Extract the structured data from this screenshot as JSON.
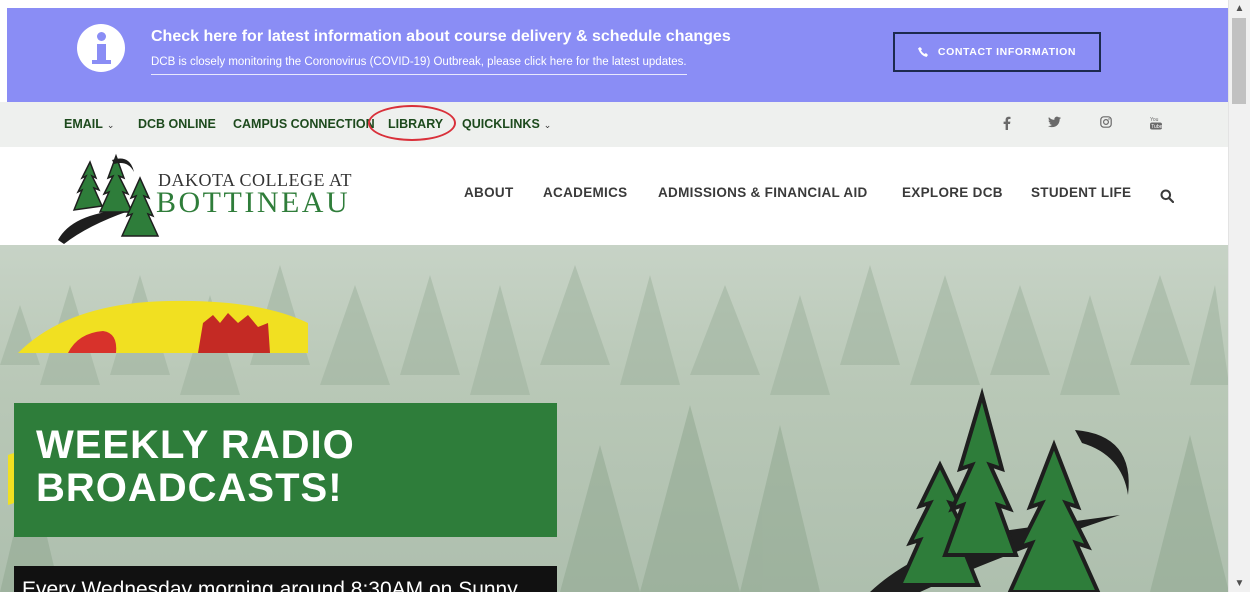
{
  "banner": {
    "title": "Check here for latest information about course delivery & schedule changes",
    "subtitle": "DCB is closely monitoring the Coronovirus (COVID-19) Outbreak, please click here for the latest updates.",
    "contact_button": "CONTACT INFORMATION",
    "color": "#8a8df5"
  },
  "utility_nav": {
    "items": [
      {
        "label": "EMAIL",
        "dropdown": true
      },
      {
        "label": "DCB ONLINE",
        "dropdown": false
      },
      {
        "label": "CAMPUS CONNECTION",
        "dropdown": false
      },
      {
        "label": "LIBRARY",
        "dropdown": false
      },
      {
        "label": "QUICKLINKS",
        "dropdown": true
      }
    ],
    "social": [
      "facebook-icon",
      "twitter-icon",
      "instagram-icon",
      "youtube-icon"
    ]
  },
  "logo": {
    "line1": "DAKOTA COLLEGE AT",
    "line2": "BOTTINEAU"
  },
  "main_nav": {
    "items": [
      "ABOUT",
      "ACADEMICS",
      "ADMISSIONS & FINANCIAL AID",
      "EXPLORE DCB",
      "STUDENT LIFE"
    ]
  },
  "hero": {
    "title_line1": "WEEKLY RADIO",
    "title_line2": "BROADCASTS!",
    "caption": "Every Wednesday morning around 8:30AM on Sunny"
  },
  "colors": {
    "brand_green": "#2e7d3a",
    "annotation_red": "#d9303a"
  }
}
